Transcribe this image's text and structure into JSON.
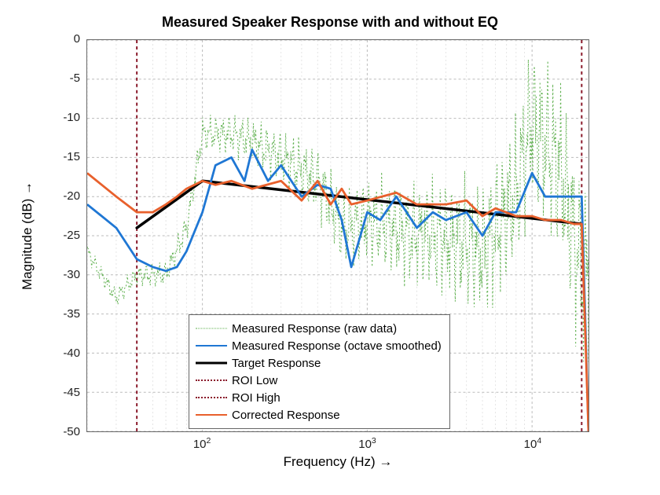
{
  "chart_data": {
    "type": "line",
    "title": "Measured Speaker Response with and without EQ",
    "xlabel": "Frequency  (Hz)   →",
    "ylabel": "Magnitude  (dB)   →",
    "xscale": "log",
    "xlim": [
      20,
      22000
    ],
    "ylim": [
      -50,
      0
    ],
    "xticks_major": [
      100,
      1000,
      10000
    ],
    "xtick_labels": [
      "10²",
      "10³",
      "10⁴"
    ],
    "yticks": [
      0,
      -5,
      -10,
      -15,
      -20,
      -25,
      -30,
      -35,
      -40,
      -45,
      -50
    ],
    "roi_low_hz": 40,
    "roi_high_hz": 20000,
    "legend": [
      {
        "label": "Measured Response (raw data)",
        "color": "#5fb04f",
        "style": "dotted",
        "width": 1
      },
      {
        "label": "Measured Response (octave smoothed)",
        "color": "#1f77d4",
        "style": "solid",
        "width": 2.8
      },
      {
        "label": "Target Response",
        "color": "#000000",
        "style": "solid",
        "width": 3.5
      },
      {
        "label": "ROI Low",
        "color": "#8a1a2b",
        "style": "dotted",
        "width": 2
      },
      {
        "label": "ROI High",
        "color": "#8a1a2b",
        "style": "dotted",
        "width": 2
      },
      {
        "label": "Corrected Response",
        "color": "#e8602c",
        "style": "solid",
        "width": 2.8
      }
    ],
    "series": [
      {
        "name": "Target Response",
        "x": [
          40,
          100,
          20000
        ],
        "y": [
          -24,
          -18,
          -23.5
        ]
      },
      {
        "name": "Measured Response (octave smoothed)",
        "x": [
          20,
          30,
          40,
          50,
          60,
          70,
          80,
          100,
          120,
          150,
          180,
          200,
          250,
          300,
          400,
          500,
          600,
          700,
          800,
          1000,
          1200,
          1500,
          2000,
          2500,
          3000,
          4000,
          5000,
          6000,
          8000,
          10000,
          12000,
          15000,
          18000,
          20000,
          22000
        ],
        "y": [
          -21,
          -24,
          -28,
          -29,
          -29.5,
          -29,
          -27,
          -22,
          -16,
          -15,
          -18,
          -14,
          -18,
          -16,
          -20,
          -18.5,
          -19,
          -23,
          -29,
          -22,
          -23,
          -20,
          -24,
          -22,
          -23,
          -22,
          -25,
          -22,
          -22,
          -17,
          -20,
          -20,
          -20,
          -20,
          -50
        ]
      },
      {
        "name": "Corrected Response",
        "x": [
          20,
          30,
          40,
          50,
          60,
          70,
          80,
          100,
          120,
          150,
          200,
          300,
          400,
          500,
          600,
          700,
          800,
          1000,
          1500,
          2000,
          3000,
          4000,
          5000,
          6000,
          8000,
          10000,
          12000,
          15000,
          18000,
          20000,
          22000
        ],
        "y": [
          -17,
          -20,
          -22,
          -22,
          -21,
          -20,
          -19,
          -18,
          -18.5,
          -18,
          -19,
          -18,
          -20.5,
          -18,
          -21,
          -19,
          -21,
          -20.5,
          -19.5,
          -21,
          -21,
          -20.5,
          -22.5,
          -21.5,
          -22.5,
          -22.5,
          -23,
          -23,
          -23.5,
          -23.5,
          -50
        ]
      },
      {
        "name": "Measured Response (raw data)",
        "note": "highly oscillatory; values are representative envelope",
        "x": [
          20,
          30,
          40,
          60,
          80,
          100,
          150,
          200,
          300,
          500,
          700,
          1000,
          2000,
          3000,
          5000,
          8000,
          10000,
          15000,
          20000
        ],
        "y": [
          -27,
          -33,
          -30,
          -30,
          -24,
          -12,
          -12,
          -13,
          -15,
          -18,
          -24,
          -23,
          -25,
          -25,
          -27,
          -20,
          -10,
          -17,
          -30
        ]
      }
    ]
  }
}
